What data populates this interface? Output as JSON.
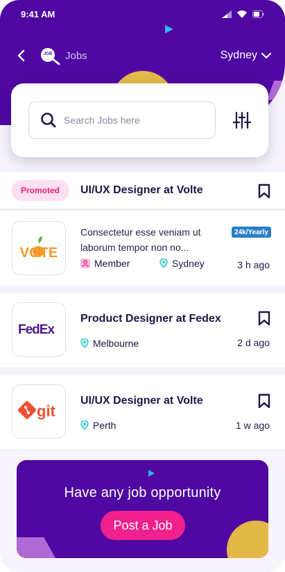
{
  "status": {
    "time": "9:41 AM"
  },
  "header": {
    "title": "Jobs",
    "logo_text": "JOB",
    "city": "Sydney"
  },
  "search": {
    "placeholder": "Search Jobs here"
  },
  "promoted": {
    "badge": "Promoted",
    "title": "UI/UX Designer at Volte"
  },
  "jobs": [
    {
      "company": "VOTE",
      "description": "Consectetur esse veniam ut laborum tempor non no...",
      "salary": "24k/Yearly",
      "type": "Member",
      "location": "Sydney",
      "ago": "3 h ago"
    },
    {
      "company": "FedEx",
      "title": "Product Designer at Fedex",
      "location": "Melbourne",
      "ago": "2 d ago"
    },
    {
      "company": "git",
      "title": "UI/UX Designer at Volte",
      "location": "Perth",
      "ago": "1 w ago"
    }
  ],
  "cta": {
    "text": "Have any job opportunity",
    "button": "Post a Job"
  },
  "colors": {
    "primary": "#4f08a1",
    "accent": "#f0218c",
    "yellow": "#e2b948",
    "teal": "#2ec4c4"
  }
}
